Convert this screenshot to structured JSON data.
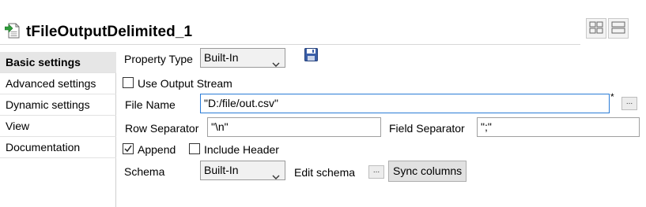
{
  "header": {
    "title": "tFileOutputDelimited_1",
    "icon": "file-output-delimited-icon",
    "layout_buttons": [
      "grid-layout-icon",
      "list-layout-icon"
    ]
  },
  "sidebar": {
    "items": [
      {
        "label": "Basic settings",
        "active": true
      },
      {
        "label": "Advanced settings",
        "active": false
      },
      {
        "label": "Dynamic settings",
        "active": false
      },
      {
        "label": "View",
        "active": false
      },
      {
        "label": "Documentation",
        "active": false
      }
    ]
  },
  "form": {
    "property_type": {
      "label": "Property Type",
      "value": "Built-In"
    },
    "use_output_stream": {
      "label": "Use Output Stream",
      "checked": false
    },
    "file_name": {
      "label": "File Name",
      "value": "\"D:/file/out.csv\"",
      "required_marker": "*",
      "browse_label": "..."
    },
    "row_separator": {
      "label": "Row Separator",
      "value": "\"\\n\""
    },
    "field_separator": {
      "label": "Field Separator",
      "value": "\";\""
    },
    "append": {
      "label": "Append",
      "checked": true
    },
    "include_header": {
      "label": "Include Header",
      "checked": false
    },
    "schema": {
      "label": "Schema",
      "value": "Built-In"
    },
    "edit_schema": {
      "label": "Edit schema",
      "button_label": "..."
    },
    "sync_columns": {
      "label": "Sync columns"
    }
  },
  "colors": {
    "focus_border": "#2a7cd6",
    "active_sidebar_bg": "#e6e6e6",
    "save_icon": "#3a5ea8"
  }
}
